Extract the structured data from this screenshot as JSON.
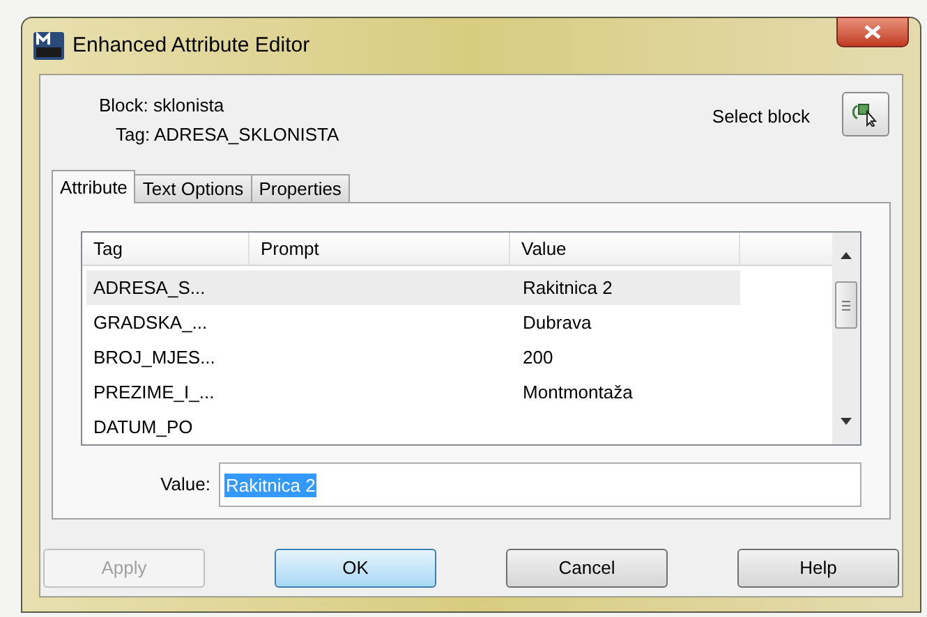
{
  "window": {
    "title": "Enhanced Attribute Editor"
  },
  "block": "Block: sklonista",
  "tag": "Tag: ADRESA_SKLONISTA",
  "select_block": "Select block",
  "tabs": [
    {
      "label": "Attribute",
      "selected": true
    },
    {
      "label": "Text Options",
      "selected": false
    },
    {
      "label": "Properties",
      "selected": false
    }
  ],
  "table": {
    "columns": [
      "Tag",
      "Prompt",
      "Value"
    ],
    "rows": [
      {
        "tag": "ADRESA_S...",
        "prompt": "",
        "value": "Rakitnica 2",
        "selected": true
      },
      {
        "tag": "GRADSKA_...",
        "value": "Dubrava",
        "selected": false
      },
      {
        "tag": "BROJ_MJES...",
        "value": "200",
        "selected": false
      },
      {
        "tag": "PREZIME_I_...",
        "value": "Montmontaža",
        "selected": false
      },
      {
        "tag": "DATUM_PO",
        "value": "",
        "selected": false
      }
    ]
  },
  "value_field": {
    "label": "Value:",
    "value": "Rakitnica 2"
  },
  "buttons": [
    {
      "label": "Apply",
      "disabled": true,
      "default": false
    },
    {
      "label": "OK",
      "disabled": false,
      "default": true
    },
    {
      "label": "Cancel",
      "disabled": false,
      "default": false
    },
    {
      "label": "Help",
      "disabled": false,
      "default": false
    }
  ]
}
